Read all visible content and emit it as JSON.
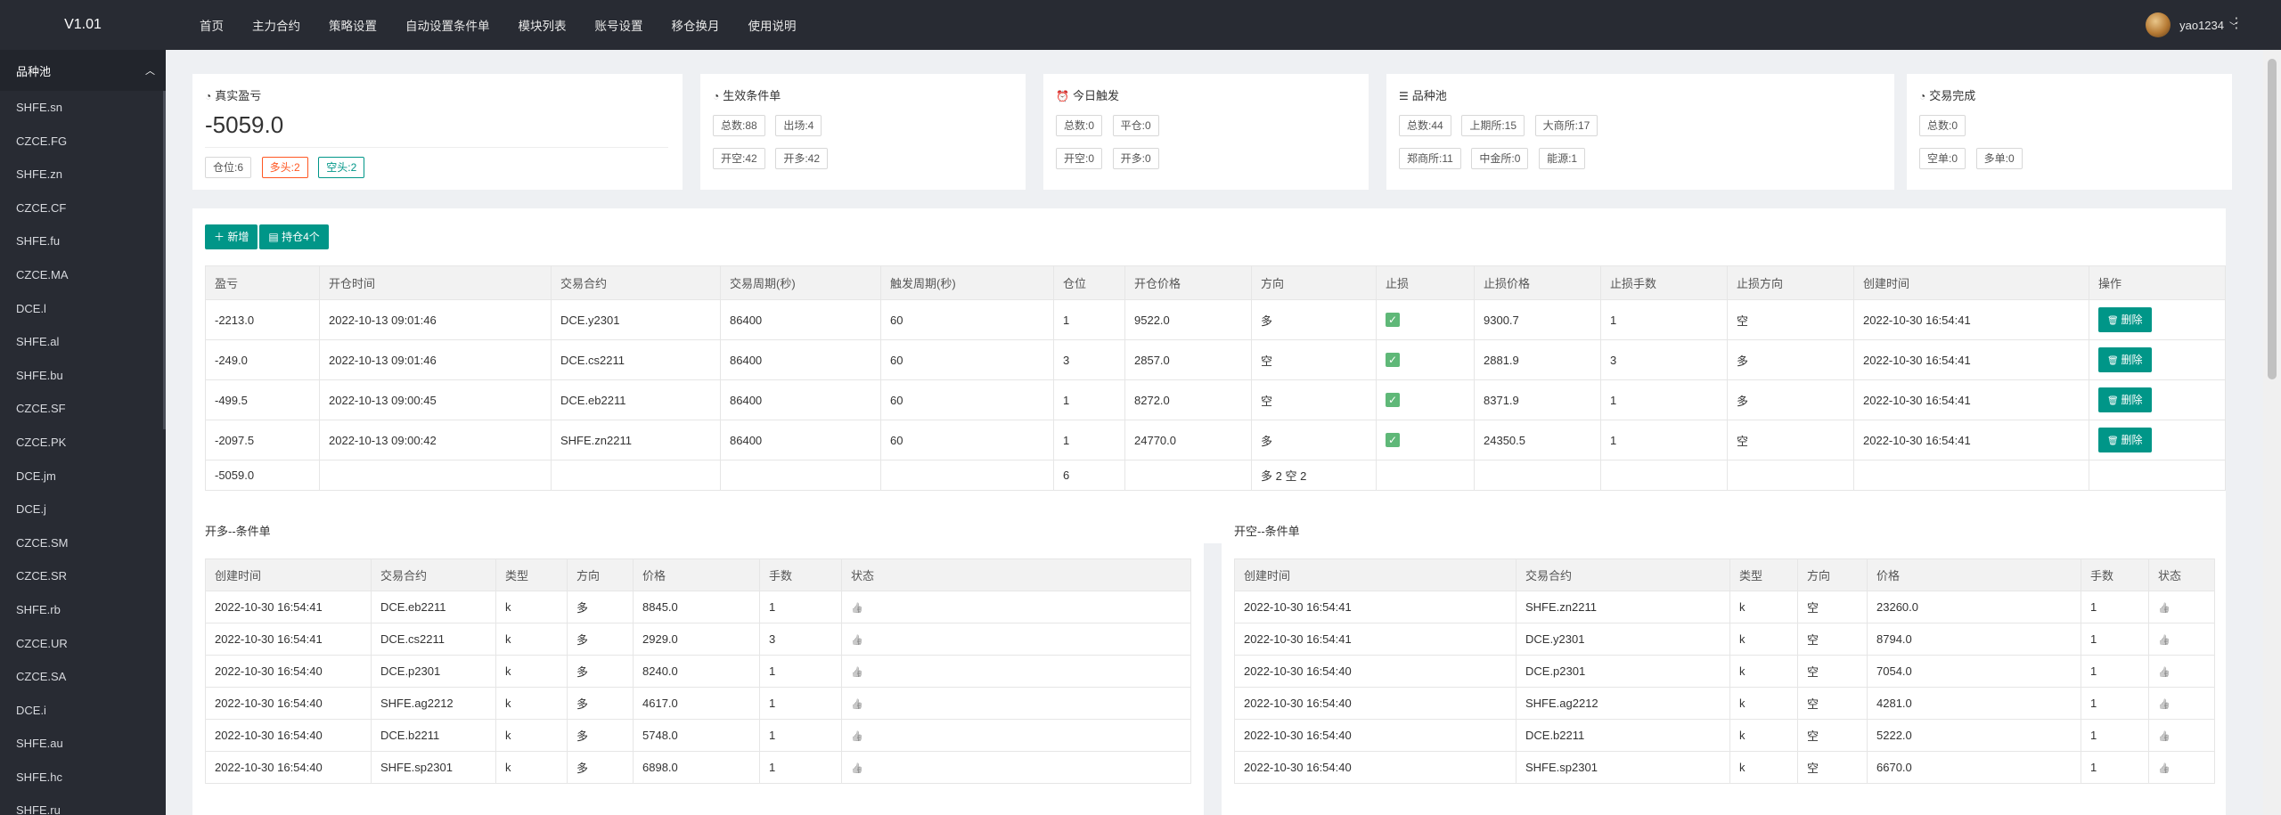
{
  "app": {
    "version": "V1.01"
  },
  "sidebar": {
    "pool_title": "品种池",
    "items": [
      "SHFE.sn",
      "CZCE.FG",
      "SHFE.zn",
      "CZCE.CF",
      "SHFE.fu",
      "CZCE.MA",
      "DCE.l",
      "SHFE.al",
      "SHFE.bu",
      "CZCE.SF",
      "CZCE.PK",
      "DCE.jm",
      "DCE.j",
      "CZCE.SM",
      "CZCE.SR",
      "SHFE.rb",
      "CZCE.UR",
      "CZCE.SA",
      "DCE.i",
      "SHFE.au",
      "SHFE.hc",
      "SHFE.ru"
    ]
  },
  "nav": [
    "首页",
    "主力合约",
    "策略设置",
    "自动设置条件单",
    "模块列表",
    "账号设置",
    "移仓换月",
    "使用说明"
  ],
  "user": {
    "name": "yao1234"
  },
  "stats": {
    "profit": {
      "title": "真实盈亏",
      "value": "-5059.0",
      "tags": [
        "仓位:6",
        "多头:2",
        "空头:2"
      ]
    },
    "conditions": {
      "title": "生效条件单",
      "tags": [
        "总数:88",
        "出场:4",
        "开空:42",
        "开多:42"
      ]
    },
    "today": {
      "title": "今日触发",
      "tags": [
        "总数:0",
        "平仓:0",
        "开空:0",
        "开多:0"
      ]
    },
    "pool": {
      "title": "品种池",
      "tags": [
        "总数:44",
        "上期所:15",
        "大商所:17",
        "郑商所:11",
        "中金所:0",
        "能源:1"
      ]
    },
    "done": {
      "title": "交易完成",
      "tags": [
        "总数:0",
        "空单:0",
        "多单:0"
      ]
    }
  },
  "toolbar": {
    "add": "新增",
    "hold": "持仓4个"
  },
  "positions": {
    "headers": [
      "盈亏",
      "开仓时间",
      "交易合约",
      "交易周期(秒)",
      "触发周期(秒)",
      "仓位",
      "开仓价格",
      "方向",
      "止损",
      "止损价格",
      "止损手数",
      "止损方向",
      "创建时间",
      "操作"
    ],
    "rows": [
      [
        "-2213.0",
        "2022-10-13 09:01:46",
        "DCE.y2301",
        "86400",
        "60",
        "1",
        "9522.0",
        "多",
        "",
        "9300.7",
        "1",
        "空",
        "2022-10-30 16:54:41",
        ""
      ],
      [
        "-249.0",
        "2022-10-13 09:01:46",
        "DCE.cs2211",
        "86400",
        "60",
        "3",
        "2857.0",
        "空",
        "",
        "2881.9",
        "3",
        "多",
        "2022-10-30 16:54:41",
        ""
      ],
      [
        "-499.5",
        "2022-10-13 09:00:45",
        "DCE.eb2211",
        "86400",
        "60",
        "1",
        "8272.0",
        "空",
        "",
        "8371.9",
        "1",
        "多",
        "2022-10-30 16:54:41",
        ""
      ],
      [
        "-2097.5",
        "2022-10-13 09:00:42",
        "SHFE.zn2211",
        "86400",
        "60",
        "1",
        "24770.0",
        "多",
        "",
        "24350.5",
        "1",
        "空",
        "2022-10-30 16:54:41",
        ""
      ]
    ],
    "summary": [
      "-5059.0",
      "",
      "",
      "",
      "",
      "6",
      "",
      "多 2 空 2",
      "",
      "",
      "",
      "",
      "",
      ""
    ],
    "delete_label": "删除"
  },
  "long_conditions": {
    "title": "开多--条件单",
    "headers": [
      "创建时间",
      "交易合约",
      "类型",
      "方向",
      "价格",
      "手数",
      "状态"
    ],
    "rows": [
      [
        "2022-10-30 16:54:41",
        "DCE.eb2211",
        "k",
        "多",
        "8845.0",
        "1"
      ],
      [
        "2022-10-30 16:54:41",
        "DCE.cs2211",
        "k",
        "多",
        "2929.0",
        "3"
      ],
      [
        "2022-10-30 16:54:40",
        "DCE.p2301",
        "k",
        "多",
        "8240.0",
        "1"
      ],
      [
        "2022-10-30 16:54:40",
        "SHFE.ag2212",
        "k",
        "多",
        "4617.0",
        "1"
      ],
      [
        "2022-10-30 16:54:40",
        "DCE.b2211",
        "k",
        "多",
        "5748.0",
        "1"
      ],
      [
        "2022-10-30 16:54:40",
        "SHFE.sp2301",
        "k",
        "多",
        "6898.0",
        "1"
      ]
    ]
  },
  "short_conditions": {
    "title": "开空--条件单",
    "headers": [
      "创建时间",
      "交易合约",
      "类型",
      "方向",
      "价格",
      "手数",
      "状态"
    ],
    "rows": [
      [
        "2022-10-30 16:54:41",
        "SHFE.zn2211",
        "k",
        "空",
        "23260.0",
        "1"
      ],
      [
        "2022-10-30 16:54:41",
        "DCE.y2301",
        "k",
        "空",
        "8794.0",
        "1"
      ],
      [
        "2022-10-30 16:54:40",
        "DCE.p2301",
        "k",
        "空",
        "7054.0",
        "1"
      ],
      [
        "2022-10-30 16:54:40",
        "SHFE.ag2212",
        "k",
        "空",
        "4281.0",
        "1"
      ],
      [
        "2022-10-30 16:54:40",
        "DCE.b2211",
        "k",
        "空",
        "5222.0",
        "1"
      ],
      [
        "2022-10-30 16:54:40",
        "SHFE.sp2301",
        "k",
        "空",
        "6670.0",
        "1"
      ]
    ]
  }
}
